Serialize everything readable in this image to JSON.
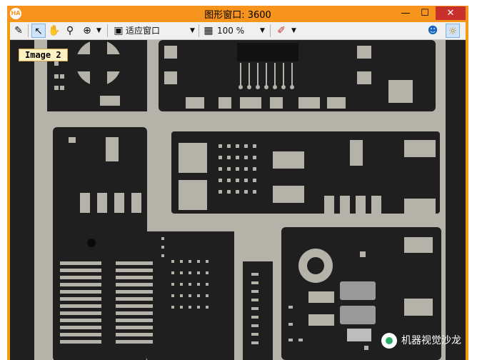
{
  "window": {
    "title": "图形窗口: 3600",
    "icon_label": "HA",
    "min_glyph": "—",
    "max_glyph": "☐",
    "close_glyph": "✕"
  },
  "toolbar": {
    "zoom_mode": "适应窗口",
    "zoom_percent": "100 %",
    "icons": [
      "edit-icon",
      "pointer-icon",
      "pan-hand-icon",
      "magnify-icon",
      "zoom-in-icon",
      "fit-window-icon",
      "zoom-percent-icon",
      "color-tools-icon",
      "figure-icon",
      "light-bulb-icon"
    ]
  },
  "canvas": {
    "image_label": "Image 2"
  },
  "watermark": {
    "text": "机器视觉沙龙"
  },
  "colors": {
    "titlebar": "#f7941d",
    "close": "#c9302c",
    "board": "#b5b2aa",
    "dark": "#1f1f1f"
  }
}
